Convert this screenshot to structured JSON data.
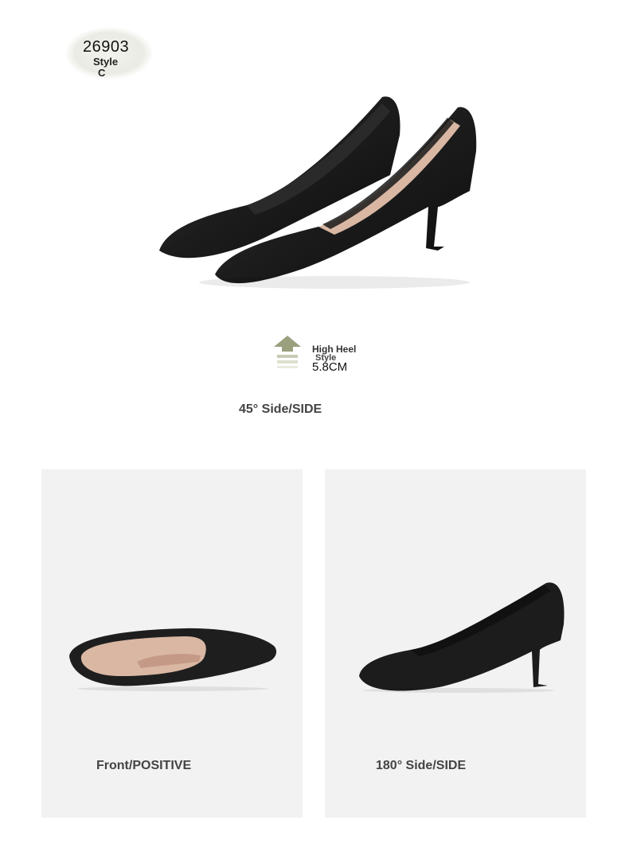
{
  "badge": {
    "code": "26903",
    "style_label": "Style",
    "variant": "C"
  },
  "heel_info": {
    "title": "High Heel",
    "subtitle": "Style",
    "height": "5.8CM"
  },
  "views": {
    "side45": "45° Side/SIDE",
    "front": "Front/POSITIVE",
    "side180": "180° Side/SIDE"
  },
  "colors": {
    "shoe": "#1e1e1e",
    "lining": "#d9b7a3",
    "panel_bg": "#f2f2f2",
    "arrow": "#9aa07e"
  }
}
